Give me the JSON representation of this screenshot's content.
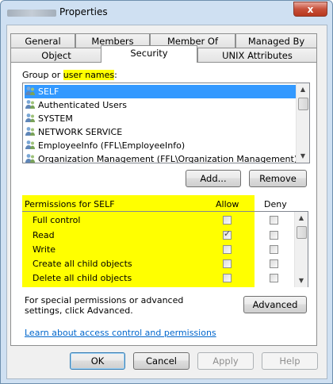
{
  "window": {
    "title": "Properties",
    "close_label": "x"
  },
  "tabs_row1": [
    {
      "label": "General"
    },
    {
      "label": "Members"
    },
    {
      "label": "Member Of"
    },
    {
      "label": "Managed By"
    }
  ],
  "tabs_row2": [
    {
      "label": "Object"
    },
    {
      "label": "Security"
    },
    {
      "label": "UNIX Attributes"
    }
  ],
  "group_label": {
    "prefix": "Group or ",
    "highlight": "user names",
    "suffix": ":"
  },
  "principals": [
    {
      "name": "SELF",
      "selected": true
    },
    {
      "name": "Authenticated Users",
      "selected": false
    },
    {
      "name": "SYSTEM",
      "selected": false
    },
    {
      "name": "NETWORK SERVICE",
      "selected": false
    },
    {
      "name": "EmployeeInfo (FFL\\EmployeeInfo)",
      "selected": false
    },
    {
      "name": "Organization Management (FFL\\Organization Management)",
      "selected": false
    }
  ],
  "buttons": {
    "add": "Add...",
    "remove": "Remove",
    "advanced": "Advanced",
    "ok": "OK",
    "cancel": "Cancel",
    "apply": "Apply",
    "help": "Help"
  },
  "permissions": {
    "header": "Permissions for SELF",
    "allow_header": "Allow",
    "deny_header": "Deny",
    "rows": [
      {
        "name": "Full control",
        "allow": false,
        "deny": false
      },
      {
        "name": "Read",
        "allow": true,
        "deny": false
      },
      {
        "name": "Write",
        "allow": false,
        "deny": false
      },
      {
        "name": "Create all child objects",
        "allow": false,
        "deny": false
      },
      {
        "name": "Delete all child objects",
        "allow": false,
        "deny": false
      }
    ]
  },
  "advanced_note": "For special permissions or advanced settings, click Advanced.",
  "learn_link": "Learn about access control and permissions"
}
